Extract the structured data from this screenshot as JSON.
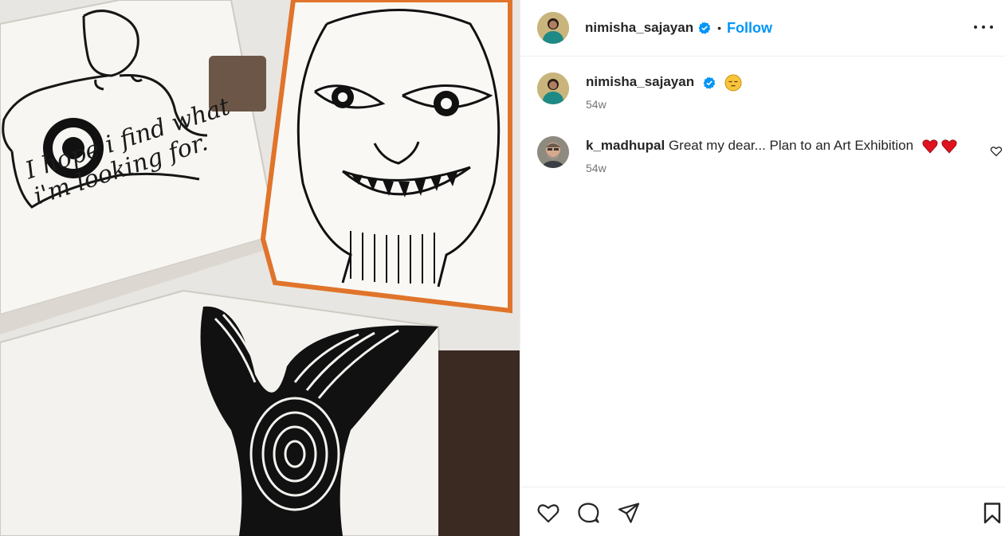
{
  "post": {
    "author": "nimisha_sajayan",
    "follow_label": "Follow",
    "separator": "•",
    "media_handwriting_line1": "I hope i find what",
    "media_handwriting_line2": "i'm looking for."
  },
  "caption": {
    "username": "nimisha_sajayan",
    "text": "",
    "emoji": "pensive-face",
    "time": "54w"
  },
  "comments": [
    {
      "username": "k_madhupal",
      "text": "Great my dear... Plan to an Art Exhibition",
      "emoji": "two-red-hearts",
      "time": "54w"
    }
  ],
  "icons": {
    "verified": "verified-badge-icon",
    "more": "more-options-icon",
    "like": "heart-icon",
    "comment": "comment-icon",
    "share": "share-icon",
    "save": "bookmark-icon",
    "comment_like": "small-heart-icon"
  },
  "colors": {
    "link_blue": "#0095f6",
    "text": "#262626",
    "muted": "#737373",
    "heart_red": "#e0121f",
    "border": "#efefef"
  }
}
